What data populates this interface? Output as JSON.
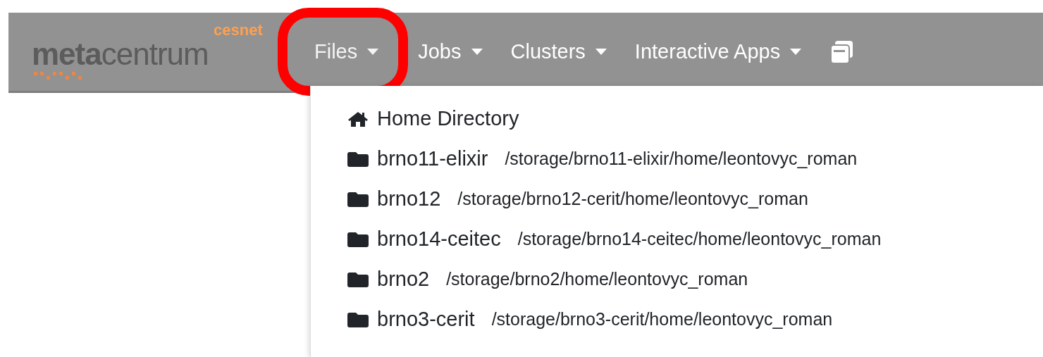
{
  "logo": {
    "text": "**meta**centrum",
    "subtext": "cesnet"
  },
  "nav": [
    {
      "label": "Files",
      "selected": true,
      "circled": true
    },
    {
      "label": "Jobs",
      "selected": false,
      "circled": false
    },
    {
      "label": "Clusters",
      "selected": false,
      "circled": false
    },
    {
      "label": "Interactive Apps",
      "selected": false,
      "circled": false
    }
  ],
  "dropdown": [
    {
      "kind": "home",
      "name": "Home Directory"
    },
    {
      "kind": "folder",
      "name": "brno11-elixir",
      "path": "/storage/brno11-elixir/home/leontovyc_roman"
    },
    {
      "kind": "folder",
      "name": "brno12",
      "path": "/storage/brno12-cerit/home/leontovyc_roman"
    },
    {
      "kind": "folder",
      "name": "brno14-ceitec",
      "path": "/storage/brno14-ceitec/home/leontovyc_roman"
    },
    {
      "kind": "folder",
      "name": "brno2",
      "path": "/storage/brno2/home/leontovyc_roman"
    },
    {
      "kind": "folder",
      "name": "brno3-cerit",
      "path": "/storage/brno3-cerit/home/leontovyc_roman"
    }
  ]
}
